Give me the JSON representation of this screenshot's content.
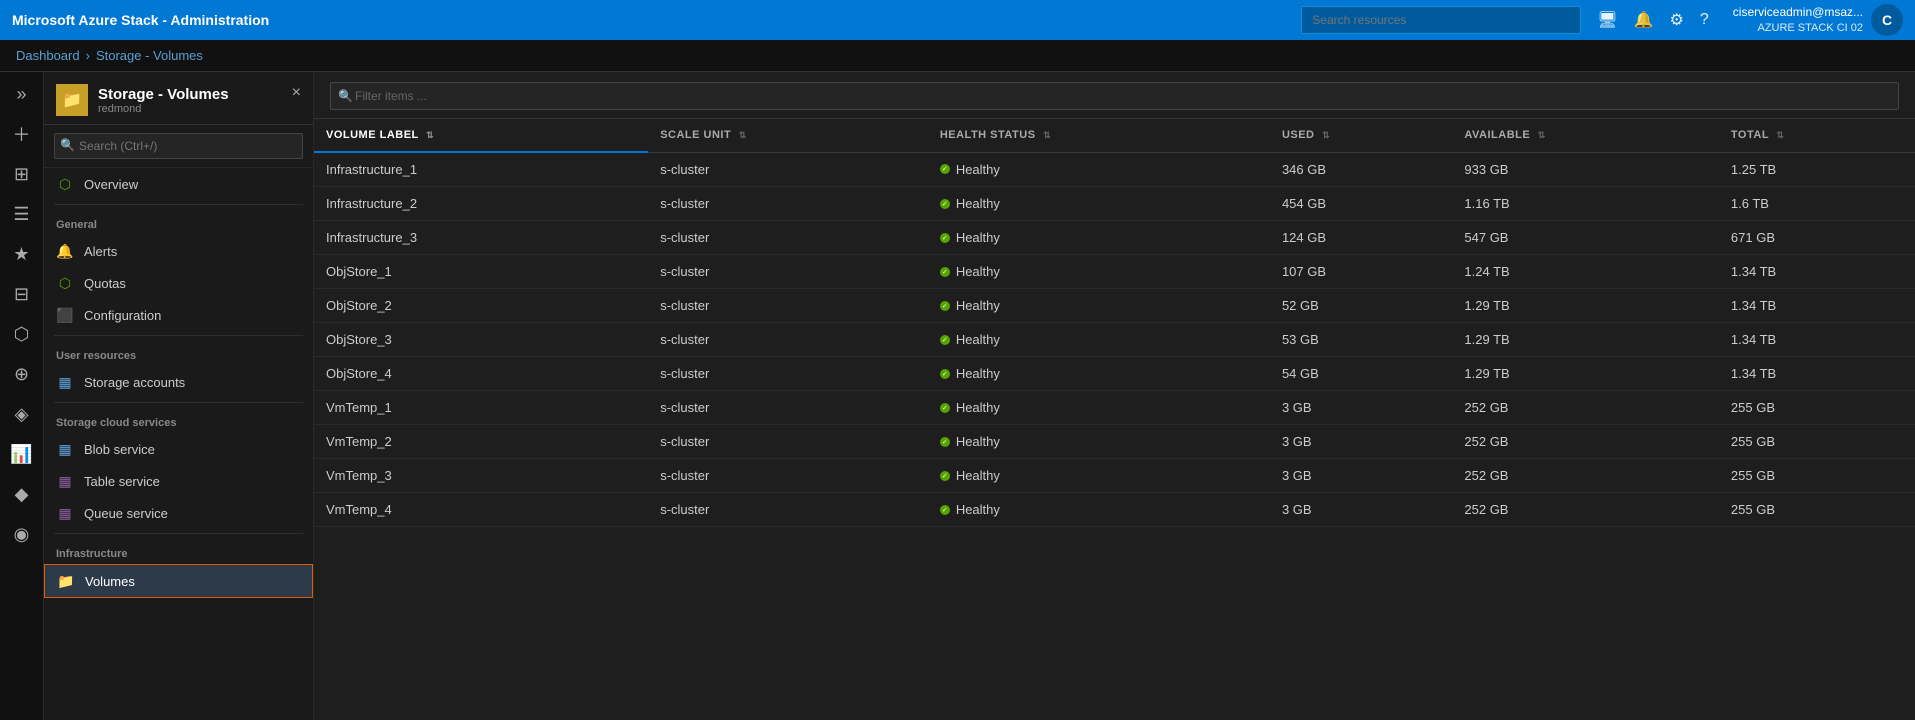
{
  "app": {
    "title": "Microsoft Azure Stack - Administration",
    "user": {
      "name": "ciserviceadmin@msaz...",
      "subtitle": "AZURE STACK CI 02",
      "avatar_text": "C"
    }
  },
  "topbar": {
    "search_placeholder": "Search resources"
  },
  "breadcrumb": {
    "items": [
      "Dashboard",
      "Storage - Volumes"
    ],
    "separator": "›"
  },
  "page": {
    "icon": "📁",
    "title": "Storage - Volumes",
    "subtitle": "redmond",
    "close_label": "×"
  },
  "left_nav": {
    "search_placeholder": "Search (Ctrl+/)",
    "sections": [
      {
        "label": "",
        "items": [
          {
            "id": "overview",
            "icon": "⬡",
            "icon_color": "#57a300",
            "label": "Overview"
          }
        ]
      },
      {
        "label": "General",
        "items": [
          {
            "id": "alerts",
            "icon": "🔔",
            "icon_color": "#e8b84b",
            "label": "Alerts"
          },
          {
            "id": "quotas",
            "icon": "⬡",
            "icon_color": "#57a300",
            "label": "Quotas"
          },
          {
            "id": "configuration",
            "icon": "⬛",
            "icon_color": "#e84040",
            "label": "Configuration"
          }
        ]
      },
      {
        "label": "User resources",
        "items": [
          {
            "id": "storage-accounts",
            "icon": "▦",
            "icon_color": "#5ea0d8",
            "label": "Storage accounts"
          }
        ]
      },
      {
        "label": "Storage cloud services",
        "items": [
          {
            "id": "blob-service",
            "icon": "▦",
            "icon_color": "#5ea0d8",
            "label": "Blob service"
          },
          {
            "id": "table-service",
            "icon": "▦",
            "icon_color": "#8b5ea0",
            "label": "Table service"
          },
          {
            "id": "queue-service",
            "icon": "▦",
            "icon_color": "#8b5ea0",
            "label": "Queue service"
          }
        ]
      },
      {
        "label": "Infrastructure",
        "items": [
          {
            "id": "volumes",
            "icon": "📁",
            "icon_color": "#c8a028",
            "label": "Volumes",
            "active": true
          }
        ]
      }
    ]
  },
  "table": {
    "filter_placeholder": "Filter items ...",
    "columns": [
      {
        "id": "volume_label",
        "label": "VOLUME LABEL",
        "active": true
      },
      {
        "id": "scale_unit",
        "label": "SCALE UNIT"
      },
      {
        "id": "health_status",
        "label": "HEALTH STATUS"
      },
      {
        "id": "used",
        "label": "USED"
      },
      {
        "id": "available",
        "label": "AVAILABLE"
      },
      {
        "id": "total",
        "label": "TOTAL"
      }
    ],
    "rows": [
      {
        "volume_label": "Infrastructure_1",
        "scale_unit": "s-cluster",
        "health_status": "Healthy",
        "used": "346 GB",
        "available": "933 GB",
        "total": "1.25 TB"
      },
      {
        "volume_label": "Infrastructure_2",
        "scale_unit": "s-cluster",
        "health_status": "Healthy",
        "used": "454 GB",
        "available": "1.16 TB",
        "total": "1.6 TB"
      },
      {
        "volume_label": "Infrastructure_3",
        "scale_unit": "s-cluster",
        "health_status": "Healthy",
        "used": "124 GB",
        "available": "547 GB",
        "total": "671 GB"
      },
      {
        "volume_label": "ObjStore_1",
        "scale_unit": "s-cluster",
        "health_status": "Healthy",
        "used": "107 GB",
        "available": "1.24 TB",
        "total": "1.34 TB"
      },
      {
        "volume_label": "ObjStore_2",
        "scale_unit": "s-cluster",
        "health_status": "Healthy",
        "used": "52 GB",
        "available": "1.29 TB",
        "total": "1.34 TB"
      },
      {
        "volume_label": "ObjStore_3",
        "scale_unit": "s-cluster",
        "health_status": "Healthy",
        "used": "53 GB",
        "available": "1.29 TB",
        "total": "1.34 TB"
      },
      {
        "volume_label": "ObjStore_4",
        "scale_unit": "s-cluster",
        "health_status": "Healthy",
        "used": "54 GB",
        "available": "1.29 TB",
        "total": "1.34 TB"
      },
      {
        "volume_label": "VmTemp_1",
        "scale_unit": "s-cluster",
        "health_status": "Healthy",
        "used": "3 GB",
        "available": "252 GB",
        "total": "255 GB"
      },
      {
        "volume_label": "VmTemp_2",
        "scale_unit": "s-cluster",
        "health_status": "Healthy",
        "used": "3 GB",
        "available": "252 GB",
        "total": "255 GB"
      },
      {
        "volume_label": "VmTemp_3",
        "scale_unit": "s-cluster",
        "health_status": "Healthy",
        "used": "3 GB",
        "available": "252 GB",
        "total": "255 GB"
      },
      {
        "volume_label": "VmTemp_4",
        "scale_unit": "s-cluster",
        "health_status": "Healthy",
        "used": "3 GB",
        "available": "252 GB",
        "total": "255 GB"
      }
    ]
  },
  "icon_sidebar": {
    "items": [
      {
        "id": "expand",
        "icon": "»",
        "label": "expand"
      },
      {
        "id": "plus",
        "icon": "+",
        "label": "new"
      },
      {
        "id": "dashboard",
        "icon": "⊞",
        "label": "dashboard"
      },
      {
        "id": "nav",
        "icon": "☰",
        "label": "all-services"
      },
      {
        "id": "favorites",
        "icon": "★",
        "label": "favorites"
      },
      {
        "id": "recent",
        "icon": "⊟",
        "label": "recent"
      },
      {
        "id": "resource-groups",
        "icon": "⬡",
        "label": "resource-groups"
      },
      {
        "id": "services",
        "icon": "⚙",
        "label": "services"
      },
      {
        "id": "marketplace",
        "icon": "◈",
        "label": "marketplace"
      },
      {
        "id": "monitor",
        "icon": "📊",
        "label": "monitor"
      },
      {
        "id": "extensions",
        "icon": "⬦",
        "label": "extensions"
      },
      {
        "id": "deployments",
        "icon": "◉",
        "label": "deployments"
      }
    ]
  }
}
